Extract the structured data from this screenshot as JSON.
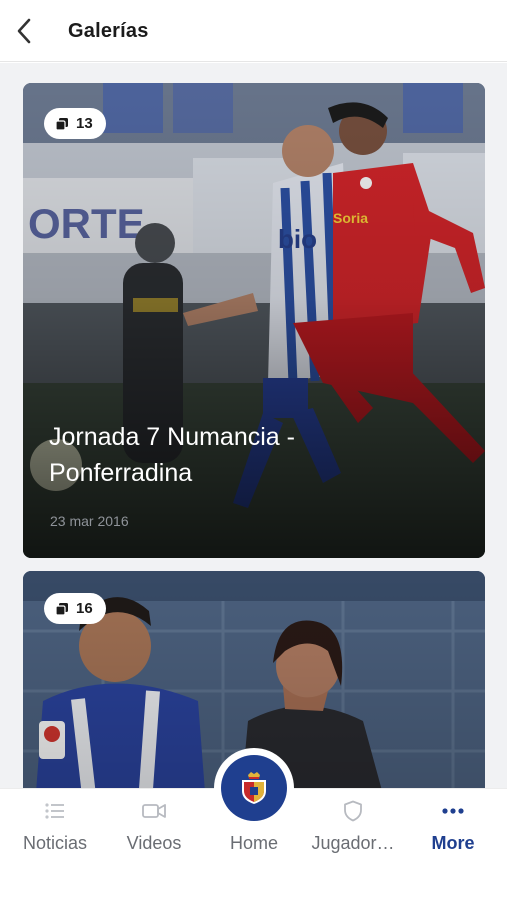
{
  "header": {
    "title": "Galerías",
    "back_icon": "chevron-left-icon"
  },
  "galleries": [
    {
      "count": "13",
      "title": "Jornada 7 Numancia - Ponferradina",
      "date": "23 mar 2016"
    },
    {
      "count": "16"
    }
  ],
  "tabs": [
    {
      "label": "Noticias",
      "icon": "list-icon",
      "active": false
    },
    {
      "label": "Videos",
      "icon": "video-camera-icon",
      "active": false
    },
    {
      "label": "Home",
      "icon": "club-crest-icon",
      "active": false
    },
    {
      "label": "Jugador…",
      "icon": "shield-icon",
      "active": false
    },
    {
      "label": "More",
      "icon": "more-dots-icon",
      "active": true
    }
  ],
  "colors": {
    "accent": "#1f3f8f",
    "inactive_tab": "#6a6d73",
    "feed_background": "#f1f2f4"
  }
}
